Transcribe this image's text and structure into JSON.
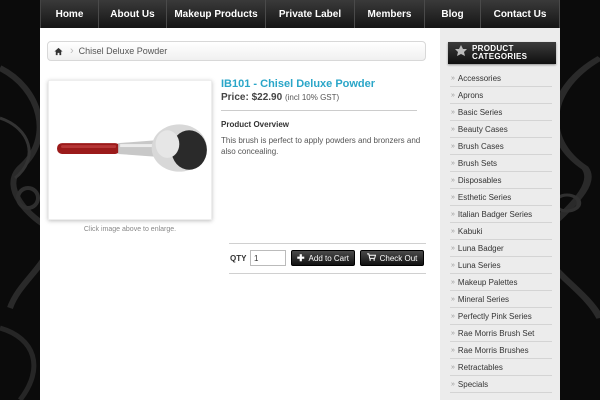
{
  "nav": {
    "items": [
      {
        "label": "Home"
      },
      {
        "label": "About Us"
      },
      {
        "label": "Makeup Products"
      },
      {
        "label": "Private Label"
      },
      {
        "label": "Members"
      },
      {
        "label": "Blog"
      },
      {
        "label": "Contact Us"
      }
    ]
  },
  "breadcrumb": {
    "home_icon": "home-icon",
    "current": "Chisel Deluxe Powder"
  },
  "product": {
    "title": "IB101 - Chisel Deluxe Powder",
    "price_label": "Price:",
    "price": "$22.90",
    "gst_note": "(incl 10% GST)",
    "overview_heading": "Product Overview",
    "overview_text": "This brush is perfect to apply powders and bronzers and also concealing.",
    "image_note": "Click image above to enlarge."
  },
  "cart": {
    "qty_label": "QTY",
    "qty_value": "1",
    "add_label": "Add to Cart",
    "checkout_label": "Check Out",
    "add_icon": "plus-icon",
    "checkout_icon": "cart-icon"
  },
  "sidebar": {
    "header_line1": "Product",
    "header_line2": "Categories",
    "categories": [
      "Accessories",
      "Aprons",
      "Basic Series",
      "Beauty Cases",
      "Brush Cases",
      "Brush Sets",
      "Disposables",
      "Esthetic Series",
      "Italian Badger Series",
      "Kabuki",
      "Luna Badger",
      "Luna Series",
      "Makeup Palettes",
      "Mineral Series",
      "Perfectly Pink Series",
      "Rae Morris Brush Set",
      "Rae Morris Brushes",
      "Retractables",
      "Specials"
    ]
  },
  "colors": {
    "accent": "#2aa6c8",
    "nav_bg": "#1e1e1e",
    "handle": "#9b1a1a"
  }
}
